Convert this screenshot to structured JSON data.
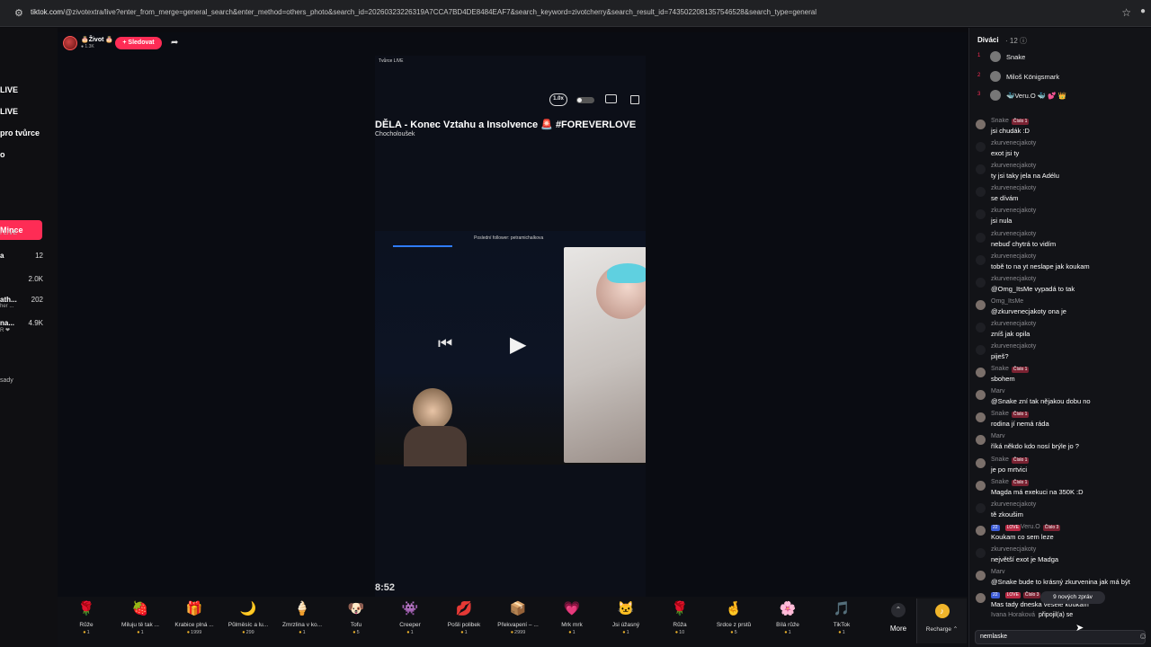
{
  "browser": {
    "url_host": "tiktok.com",
    "url_rest": "/@zivotextra/live?enter_from_merge=general_search&enter_method=others_photo&search_id=20260323226319A7CCA7BD4DE8484EAF7&search_keyword=zivotcherry&search_result_id=7435022081357546528&search_type=general"
  },
  "sidebar": {
    "links": [
      "LIVE",
      "LIVE",
      "pro tvůrce",
      "o"
    ],
    "coins_label": "Mince",
    "section_label": "í LIVE",
    "rows": [
      {
        "name": "a",
        "sub": "",
        "count": "12"
      },
      {
        "name": "",
        "sub": "",
        "count": "2.0K"
      },
      {
        "name": "ath...",
        "sub": "her ...",
        "count": "202"
      },
      {
        "name": "na...",
        "sub": "R ❤",
        "count": "4.9K"
      }
    ],
    "settings_label": "sady"
  },
  "host": {
    "name": "🎂Život 🎂",
    "likes": "● 1.3K",
    "follow_label": "+ Sledovat"
  },
  "video": {
    "tag": "Tvůrce LIVE",
    "speed": "1.0x",
    "title": "DĚLA - Konec Vztahu a Insolvence 🚨 #FOREVERLOVE",
    "subtitle": "Chocholoušek",
    "follower_note": "Poslední follower: petramichalkova",
    "timer": "8:52"
  },
  "gifts": [
    {
      "icon": "🌹",
      "name": "Růže",
      "price": "1"
    },
    {
      "icon": "🍓",
      "name": "Miluju tě tak ...",
      "price": "1"
    },
    {
      "icon": "🎁",
      "name": "Krabice plná ...",
      "price": "1999"
    },
    {
      "icon": "🌙",
      "name": "Půlměsíc a lu...",
      "price": "299"
    },
    {
      "icon": "🍦",
      "name": "Zmrzlina v ko...",
      "price": "1"
    },
    {
      "icon": "🐶",
      "name": "Tofu",
      "price": "5"
    },
    {
      "icon": "👾",
      "name": "Creeper",
      "price": "1"
    },
    {
      "icon": "💋",
      "name": "Pošli polibek",
      "price": "1"
    },
    {
      "icon": "📦",
      "name": "Překvapení – ...",
      "price": "2999"
    },
    {
      "icon": "💗",
      "name": "Mrk mrk",
      "price": "1"
    },
    {
      "icon": "🐱",
      "name": "Jsi úžasný",
      "price": "1"
    },
    {
      "icon": "🌹",
      "name": "Růža",
      "price": "10"
    },
    {
      "icon": "🤞",
      "name": "Srdce z prstů",
      "price": "5"
    },
    {
      "icon": "🌸",
      "name": "Bílá růže",
      "price": "1"
    },
    {
      "icon": "🎵",
      "name": "TikTok",
      "price": "1"
    }
  ],
  "more_label": "More",
  "recharge_label": "Recharge ⌃",
  "viewers": {
    "title": "Diváci",
    "count": "· 12 ⓘ",
    "top": [
      {
        "rank": "1",
        "name": "Snake"
      },
      {
        "rank": "2",
        "name": "Miloš Königsmark"
      },
      {
        "rank": "3",
        "name": "🐳Veru.O 🐳 💕 👑"
      }
    ]
  },
  "chat": [
    {
      "user": "Snake",
      "badge": "Číslo 1",
      "lv": "",
      "love": "",
      "text": "jsi chudák :D",
      "pic": true
    },
    {
      "user": "zkurvenecjakoty",
      "badge": "",
      "lv": "",
      "love": "",
      "text": "exot jsi ty",
      "pic": false
    },
    {
      "user": "zkurvenecjakoty",
      "badge": "",
      "lv": "",
      "love": "",
      "text": "ty jsi taky jela na Adélu",
      "pic": false
    },
    {
      "user": "zkurvenecjakoty",
      "badge": "",
      "lv": "",
      "love": "",
      "text": "se dívám",
      "pic": false
    },
    {
      "user": "zkurvenecjakoty",
      "badge": "",
      "lv": "",
      "love": "",
      "text": "jsi nula",
      "pic": false
    },
    {
      "user": "zkurvenecjakoty",
      "badge": "",
      "lv": "",
      "love": "",
      "text": "nebuď chytrá to vidím",
      "pic": false
    },
    {
      "user": "zkurvenecjakoty",
      "badge": "",
      "lv": "",
      "love": "",
      "text": "tobě to na yt neslape jak koukam",
      "pic": false
    },
    {
      "user": "zkurvenecjakoty",
      "badge": "",
      "lv": "",
      "love": "",
      "text": "@Omg_ItsMe vypadá to tak",
      "pic": false
    },
    {
      "user": "Omg_ItsMe",
      "badge": "",
      "lv": "",
      "love": "",
      "text": "@zkurvenecjakoty ona je",
      "pic": true
    },
    {
      "user": "zkurvenecjakoty",
      "badge": "",
      "lv": "",
      "love": "",
      "text": "zníš jak opila",
      "pic": false
    },
    {
      "user": "zkurvenecjakoty",
      "badge": "",
      "lv": "",
      "love": "",
      "text": "piješ?",
      "pic": false
    },
    {
      "user": "Snake",
      "badge": "Číslo 1",
      "lv": "",
      "love": "",
      "text": "sbohem",
      "pic": true
    },
    {
      "user": "Marv",
      "badge": "",
      "lv": "",
      "love": "",
      "text": "@Snake zní tak nějakou dobu no",
      "pic": true
    },
    {
      "user": "Snake",
      "badge": "Číslo 1",
      "lv": "",
      "love": "",
      "text": "rodina jí nemá ráda",
      "pic": true
    },
    {
      "user": "Marv",
      "badge": "",
      "lv": "",
      "love": "",
      "text": "říká někdo kdo nosí brýle jo ?",
      "pic": true
    },
    {
      "user": "Snake",
      "badge": "Číslo 1",
      "lv": "",
      "love": "",
      "text": "je po mrtvici",
      "pic": true
    },
    {
      "user": "Snake",
      "badge": "Číslo 1",
      "lv": "",
      "love": "",
      "text": "Magda má exekuci na 350K :D",
      "pic": true
    },
    {
      "user": "zkurvenecjakoty",
      "badge": "",
      "lv": "",
      "love": "",
      "text": "tě zkoušim",
      "pic": false
    },
    {
      "user": "Veru.O",
      "badge": "Číslo 3",
      "lv": "22",
      "love": "LOVE",
      "text": "Koukam co sem leze",
      "pic": true
    },
    {
      "user": "zkurvenecjakoty",
      "badge": "",
      "lv": "",
      "love": "",
      "text": "největší exot je Madga",
      "pic": false
    },
    {
      "user": "Marv",
      "badge": "",
      "lv": "",
      "love": "",
      "text": "@Snake bude to krásný zkurvenina jak má být",
      "pic": true
    },
    {
      "user": "",
      "badge": "Číslo 3",
      "lv": "22",
      "love": "LOVE",
      "text": "Mas tady dneska vesele koukam",
      "pic": true
    }
  ],
  "new_messages_label": "9 nových zpráv",
  "joined": {
    "name": "Ivana Horaková",
    "text": "připojil(a) se"
  },
  "chat_input_value": "nemlaske"
}
